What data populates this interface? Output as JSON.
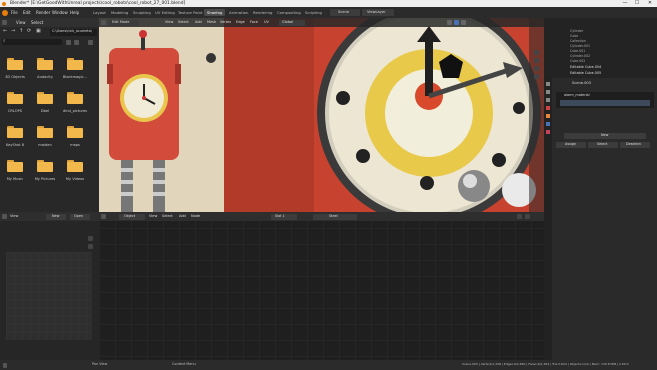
{
  "window": {
    "title": "Blender* [E:\\GetGoodWithUnreal projects\\cool_robots\\cool_robot_27_001.blend]",
    "minimize": "—",
    "maximize": "☐",
    "close": "✕"
  },
  "menu": [
    "File",
    "Edit",
    "Render",
    "Window",
    "Help"
  ],
  "workspaces": [
    "Layout",
    "Modeling",
    "Sculpting",
    "UV Editing",
    "Texture Paint",
    "Shading",
    "Animation",
    "Rendering",
    "Compositing",
    "Scripting"
  ],
  "active_workspace": "Shading",
  "scene_label": "Scene",
  "viewlayer_label": "ViewLayer",
  "file_browser": {
    "view_label": "View",
    "select_label": "Select",
    "path": "C:\\Users\\nick_ocumeto\\",
    "folders": [
      "3D Objects",
      "Audacity",
      "Blackmagic…",
      "CRLOPS",
      "Dbel",
      "dlnd_pictures",
      "KeyShot 8",
      "maiden",
      "maps",
      "My Music",
      "My Pictures",
      "My Videos"
    ]
  },
  "viewport": {
    "mode": "Edit Mode",
    "menus": [
      "View",
      "Select",
      "Add",
      "Mesh",
      "Vertex",
      "Edge",
      "Face",
      "UV"
    ],
    "global": "Global"
  },
  "outliner": {
    "items": [
      "Cylinder",
      "Cube",
      "Collection",
      "Cylinder.001",
      "Cube.001",
      "Cylinder.002",
      "Cube.002",
      "Editable Cube.004",
      "Editable Cube.005"
    ]
  },
  "properties": {
    "object_name": "Scene.003",
    "material_slot": "alarm_material",
    "buttons": [
      "New",
      "Assign",
      "Select",
      "Deselect"
    ]
  },
  "node_editor": {
    "editor_type": "Object",
    "menus": [
      "View",
      "Select",
      "Add",
      "Node"
    ],
    "slot": "Slot 1",
    "material_name": "Steel"
  },
  "image_editor": {
    "view_label": "View",
    "new_label": "New",
    "open_label": "Open"
  },
  "status": {
    "left_a": "Pan View",
    "left_b": "Context Menu",
    "right": "Scene.003 | Verts:0/1,348 | Edges:0/2,640 | Faces:0/1,364 | Tris:2,624 | Objects:1/19 | Mem: 130.8 MiB | 2.90.0"
  },
  "colors": {
    "accent": "#4772b3",
    "folder": "#f2b84b",
    "viewport_red": "#c6402e",
    "clock_yellow": "#e8c94a"
  }
}
